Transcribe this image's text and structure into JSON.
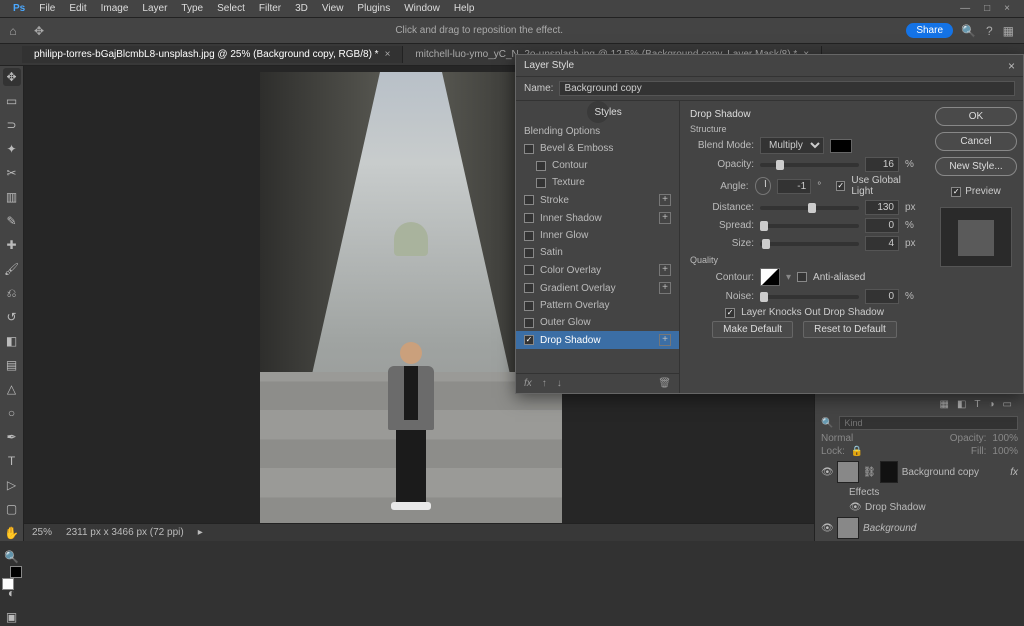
{
  "app": {
    "icon": "Ps"
  },
  "menu": [
    "File",
    "Edit",
    "Image",
    "Layer",
    "Type",
    "Select",
    "Filter",
    "3D",
    "View",
    "Plugins",
    "Window",
    "Help"
  ],
  "window_controls": {
    "min": "—",
    "max": "□",
    "close": "×"
  },
  "options_bar": {
    "message": "Click and drag to reposition the effect.",
    "share": "Share"
  },
  "tabs": [
    {
      "label": "philipp-torres-bGajBlcmbL8-unsplash.jpg @ 25% (Background copy, RGB/8) *",
      "active": true
    },
    {
      "label": "mitchell-luo-ymo_yC_N_2o-unsplash.jpg @ 12,5% (Background copy, Layer Mask/8) *",
      "active": false
    }
  ],
  "status": {
    "zoom": "25%",
    "dims": "2311 px x 3466 px (72 ppi)"
  },
  "layers_panel": {
    "search_placeholder": "Kind",
    "blend": "Normal",
    "opacity_label": "Opacity:",
    "opacity_value": "100%",
    "lock_label": "Lock:",
    "fill_label": "Fill:",
    "fill_value": "100%",
    "rows": [
      {
        "name": "Background copy",
        "fx": "fx"
      },
      {
        "name": "Effects"
      },
      {
        "name": "Drop Shadow"
      },
      {
        "name": "Background"
      }
    ]
  },
  "dialog": {
    "title": "Layer Style",
    "name_label": "Name:",
    "name_value": "Background copy",
    "left": {
      "header": "Styles",
      "blending": "Blending Options",
      "effects": [
        {
          "label": "Bevel & Emboss",
          "checked": false
        },
        {
          "label": "Contour",
          "checked": false,
          "indent": true
        },
        {
          "label": "Texture",
          "checked": false,
          "indent": true
        },
        {
          "label": "Stroke",
          "checked": false,
          "plus": true
        },
        {
          "label": "Inner Shadow",
          "checked": false,
          "plus": true
        },
        {
          "label": "Inner Glow",
          "checked": false
        },
        {
          "label": "Satin",
          "checked": false
        },
        {
          "label": "Color Overlay",
          "checked": false,
          "plus": true
        },
        {
          "label": "Gradient Overlay",
          "checked": false,
          "plus": true
        },
        {
          "label": "Pattern Overlay",
          "checked": false
        },
        {
          "label": "Outer Glow",
          "checked": false
        },
        {
          "label": "Drop Shadow",
          "checked": true,
          "plus": true,
          "selected": true
        }
      ]
    },
    "mid": {
      "heading": "Drop Shadow",
      "structure": "Structure",
      "blend_mode_label": "Blend Mode:",
      "blend_mode_value": "Multiply",
      "opacity_label": "Opacity:",
      "opacity_value": "16",
      "opacity_unit": "%",
      "angle_label": "Angle:",
      "angle_value": "-1",
      "angle_unit": "°",
      "global_label": "Use Global Light",
      "distance_label": "Distance:",
      "distance_value": "130",
      "distance_unit": "px",
      "spread_label": "Spread:",
      "spread_value": "0",
      "spread_unit": "%",
      "size_label": "Size:",
      "size_value": "4",
      "size_unit": "px",
      "quality": "Quality",
      "contour_label": "Contour:",
      "aa_label": "Anti-aliased",
      "noise_label": "Noise:",
      "noise_value": "0",
      "noise_unit": "%",
      "knockout_label": "Layer Knocks Out Drop Shadow",
      "make_default": "Make Default",
      "reset_default": "Reset to Default"
    },
    "right": {
      "ok": "OK",
      "cancel": "Cancel",
      "new_style": "New Style...",
      "preview": "Preview"
    },
    "footer": {
      "fx": "fx"
    }
  }
}
